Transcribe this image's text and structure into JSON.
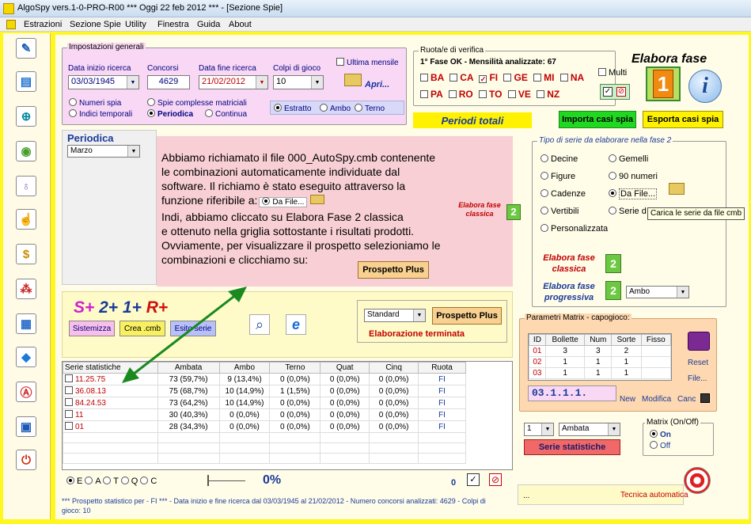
{
  "window": {
    "title": "AlgoSpy vers.1-0-PRO-R00  ***  Oggi 22 feb 2012  ***   - [Sezione Spie]"
  },
  "menu": [
    "Estrazioni",
    "Sezione Spie",
    "Utility",
    "Finestra",
    "Guida",
    "About"
  ],
  "impostazioni": {
    "group_title": "Impostazioni generali",
    "data_inizio_label": "Data inizio ricerca",
    "data_inizio": "03/03/1945",
    "concorsi_label": "Concorsi",
    "concorsi": "4629",
    "data_fine_label": "Data fine ricerca",
    "data_fine": "21/02/2012",
    "colpi_label": "Colpi di gioco",
    "colpi": "10",
    "ultima_mensile": "Ultima mensile",
    "apri": "Apri...",
    "numeri_spia": "Numeri spia",
    "indici_temporali": "Indici temporali",
    "spie_complesse": "Spie complesse matriciali",
    "periodica": "Periodica",
    "continua": "Continua",
    "estratto": "Estratto",
    "ambo": "Ambo",
    "terno": "Terno"
  },
  "ruota": {
    "group_title": "Ruota/e di verifica",
    "status": "1° Fase OK - Mensilità analizzate: 67",
    "wheels_row1": [
      "BA",
      "CA",
      "FI",
      "GE",
      "MI",
      "NA"
    ],
    "wheels_row2": [
      "PA",
      "RO",
      "TO",
      "VE",
      "NZ"
    ],
    "checked": "FI",
    "multi": "Multi"
  },
  "elabora_fase": "Elabora fase",
  "periodi_totali": "Periodi totali",
  "importa": "Importa casi spia",
  "esporta": "Esporta casi spia",
  "periodica_panel": {
    "title": "Periodica",
    "value": "Marzo"
  },
  "annotation": {
    "line1": "Abbiamo richiamato il file 000_AutoSpy.cmb contenente",
    "line2": "le combinazioni automaticamente individuate dal",
    "line3": "software. Il richiamo è stato eseguito attraverso la",
    "line4": "funzione riferibile a:",
    "dafile": "Da File...",
    "line5": "Indi, abbiamo cliccato su Elabora Fase 2 classica",
    "line6": "e ottenuto nella griglia sottostante i risultati prodotti.",
    "line7": "Ovviamente, per visualizzare il prospetto selezioniamo le",
    "line8": "combinazioni e clicchiamo su:",
    "prospetto_plus": "Prospetto Plus",
    "elabora_classica": "Elabora fase classica",
    "icon_digit": "2"
  },
  "tipo_serie": {
    "title": "Tipo di serie da elaborare nella fase 2",
    "options_left": [
      "Decine",
      "Figure",
      "Cadenze",
      "Vertibili",
      "Personalizzata"
    ],
    "options_right": [
      "Gemelli",
      "90 numeri",
      "Da File...",
      "Serie d"
    ],
    "selected": "Da File...",
    "tooltip": "Carica le serie da file cmb",
    "elabora_classica_1": "Elabora fase",
    "elabora_classica_2": "classica",
    "elabora_progressiva_1": "Elabora fase",
    "elabora_progressiva_2": "progressiva",
    "ambo_combo": "Ambo"
  },
  "logo": {
    "s": "S+",
    "two": "2+",
    "one": "1+",
    "r": "R+"
  },
  "toolbar2": {
    "sistemizza": "Sistemizza",
    "crea": "Crea .cmb",
    "esito": "Esito serie"
  },
  "prospetto_row": {
    "combo": "Standard",
    "button": "Prospetto Plus",
    "status": "Elaborazione terminata"
  },
  "table": {
    "headers": [
      "Serie statistiche",
      "Ambata",
      "Ambo",
      "Terno",
      "Quat",
      "Cinq",
      "Ruota"
    ],
    "rows": [
      [
        "11.25.75",
        "73 (59,7%)",
        "9 (13,4%)",
        "0 (0,0%)",
        "0 (0,0%)",
        "0 (0,0%)",
        "FI"
      ],
      [
        "36.08.13",
        "75 (68,7%)",
        "10 (14,9%)",
        "1 (1,5%)",
        "0 (0,0%)",
        "0 (0,0%)",
        "FI"
      ],
      [
        "84.24.53",
        "73 (64,2%)",
        "10 (14,9%)",
        "0 (0,0%)",
        "0 (0,0%)",
        "0 (0,0%)",
        "FI"
      ],
      [
        "11",
        "30 (40,3%)",
        "0 (0,0%)",
        "0 (0,0%)",
        "0 (0,0%)",
        "0 (0,0%)",
        "FI"
      ],
      [
        "01",
        "28 (34,3%)",
        "0 (0,0%)",
        "0 (0,0%)",
        "0 (0,0%)",
        "0 (0,0%)",
        "FI"
      ]
    ]
  },
  "bottom": {
    "radios": [
      "E",
      "A",
      "T",
      "Q",
      "C"
    ],
    "progress": "0%",
    "counter": "0",
    "status_line1": "*** Prospetto statistico per  - FI ***  - Data inizio e fine ricerca dal 03/03/1945 al 21/02/2012 - Numero concorsi analizzati: 4629 - Colpi di",
    "status_line2": "gioco: 10",
    "dots": "..."
  },
  "matrix": {
    "title": "Parametri Matrix - capogioco:",
    "headers": [
      "ID",
      "Bollette",
      "Num",
      "Sorte",
      "Fisso"
    ],
    "rows": [
      [
        "01",
        "3",
        "3",
        "2",
        ""
      ],
      [
        "02",
        "1",
        "1",
        "1",
        ""
      ],
      [
        "03",
        "1",
        "1",
        "1",
        ""
      ]
    ],
    "code": "03.1.1.1.",
    "reset": "Reset",
    "file": "File...",
    "new": "New",
    "modifica": "Modifica",
    "canc": "Canc",
    "onoff_title": "Matrix (On/Off)",
    "on": "On",
    "off": "Off",
    "combo_num": "1",
    "combo_sorte": "Ambata",
    "serie_btn": "Serie statistiche",
    "tecnica": "Tecnica automatica"
  }
}
